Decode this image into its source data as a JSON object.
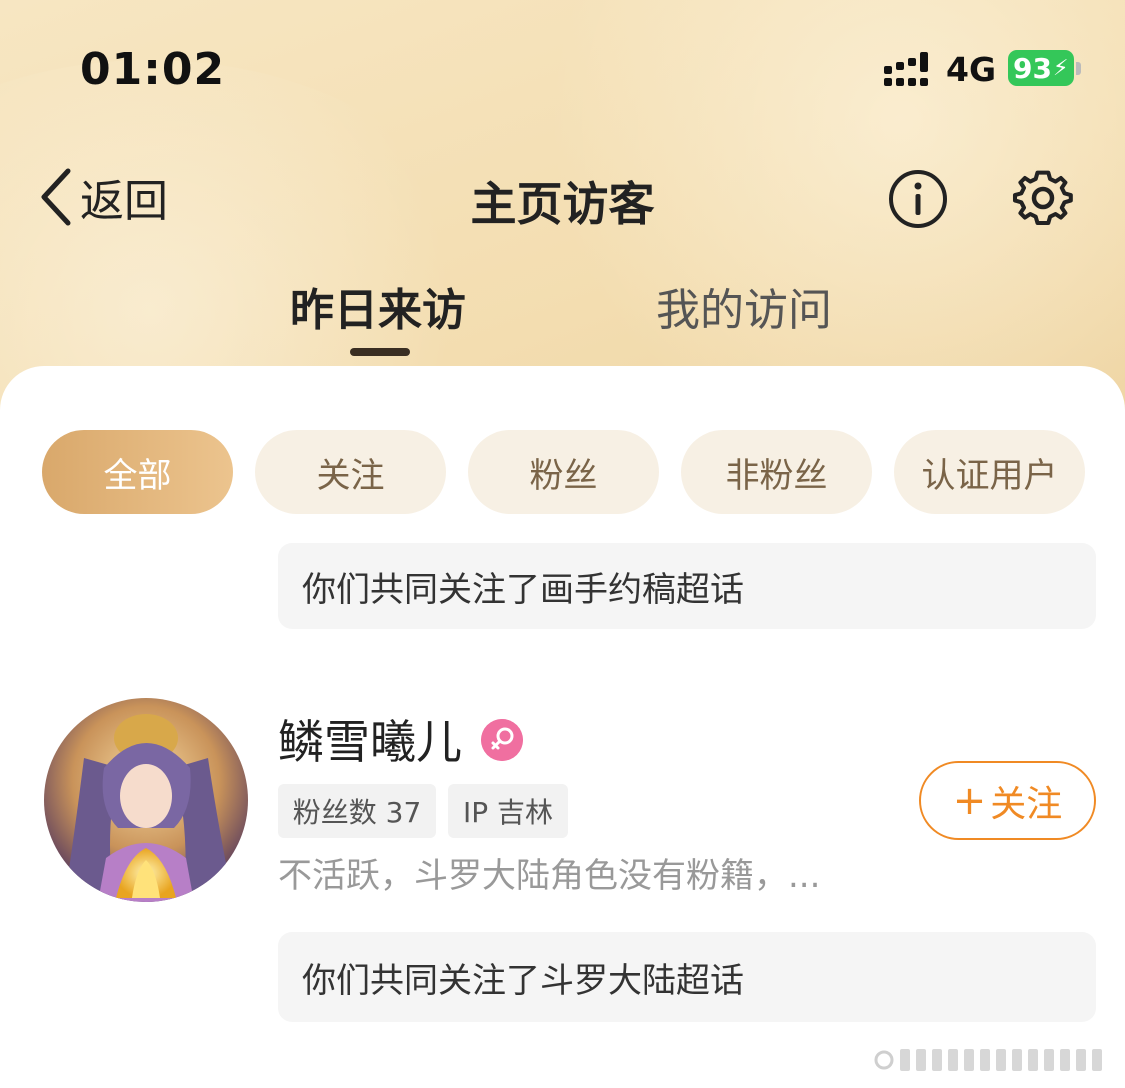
{
  "status_bar": {
    "time": "01:02",
    "network": "4G",
    "battery": "93",
    "icons": [
      "signal-icon",
      "battery-icon"
    ]
  },
  "nav": {
    "back_label": "返回",
    "title": "主页访客",
    "icons": [
      "chevron-left-icon",
      "info-icon",
      "gear-icon"
    ]
  },
  "tabs": [
    {
      "label": "昨日来访",
      "active": true
    },
    {
      "label": "我的访问",
      "active": false
    }
  ],
  "filters": [
    {
      "label": "全部",
      "active": true
    },
    {
      "label": "关注",
      "active": false
    },
    {
      "label": "粉丝",
      "active": false
    },
    {
      "label": "非粉丝",
      "active": false
    },
    {
      "label": "认证用户",
      "active": false
    }
  ],
  "visitors": [
    {
      "mutual": "你们共同关注了画手约稿超话"
    },
    {
      "name": "鳞雪曦儿",
      "gender_icon": "female-icon",
      "tags": [
        "粉丝数 37",
        "IP 吉林"
      ],
      "bio": "不活跃，斗罗大陆角色没有粉籍，...",
      "follow_label": "关注",
      "mutual": "你们共同关注了斗罗大陆超话"
    }
  ],
  "colors": {
    "accent": "#f08a24",
    "active_chip": "#dba870",
    "chip_bg": "#f7f0e4",
    "header_bg": "#f3ddb0",
    "battery": "#34c759",
    "gender_badge": "#f06fa0"
  }
}
